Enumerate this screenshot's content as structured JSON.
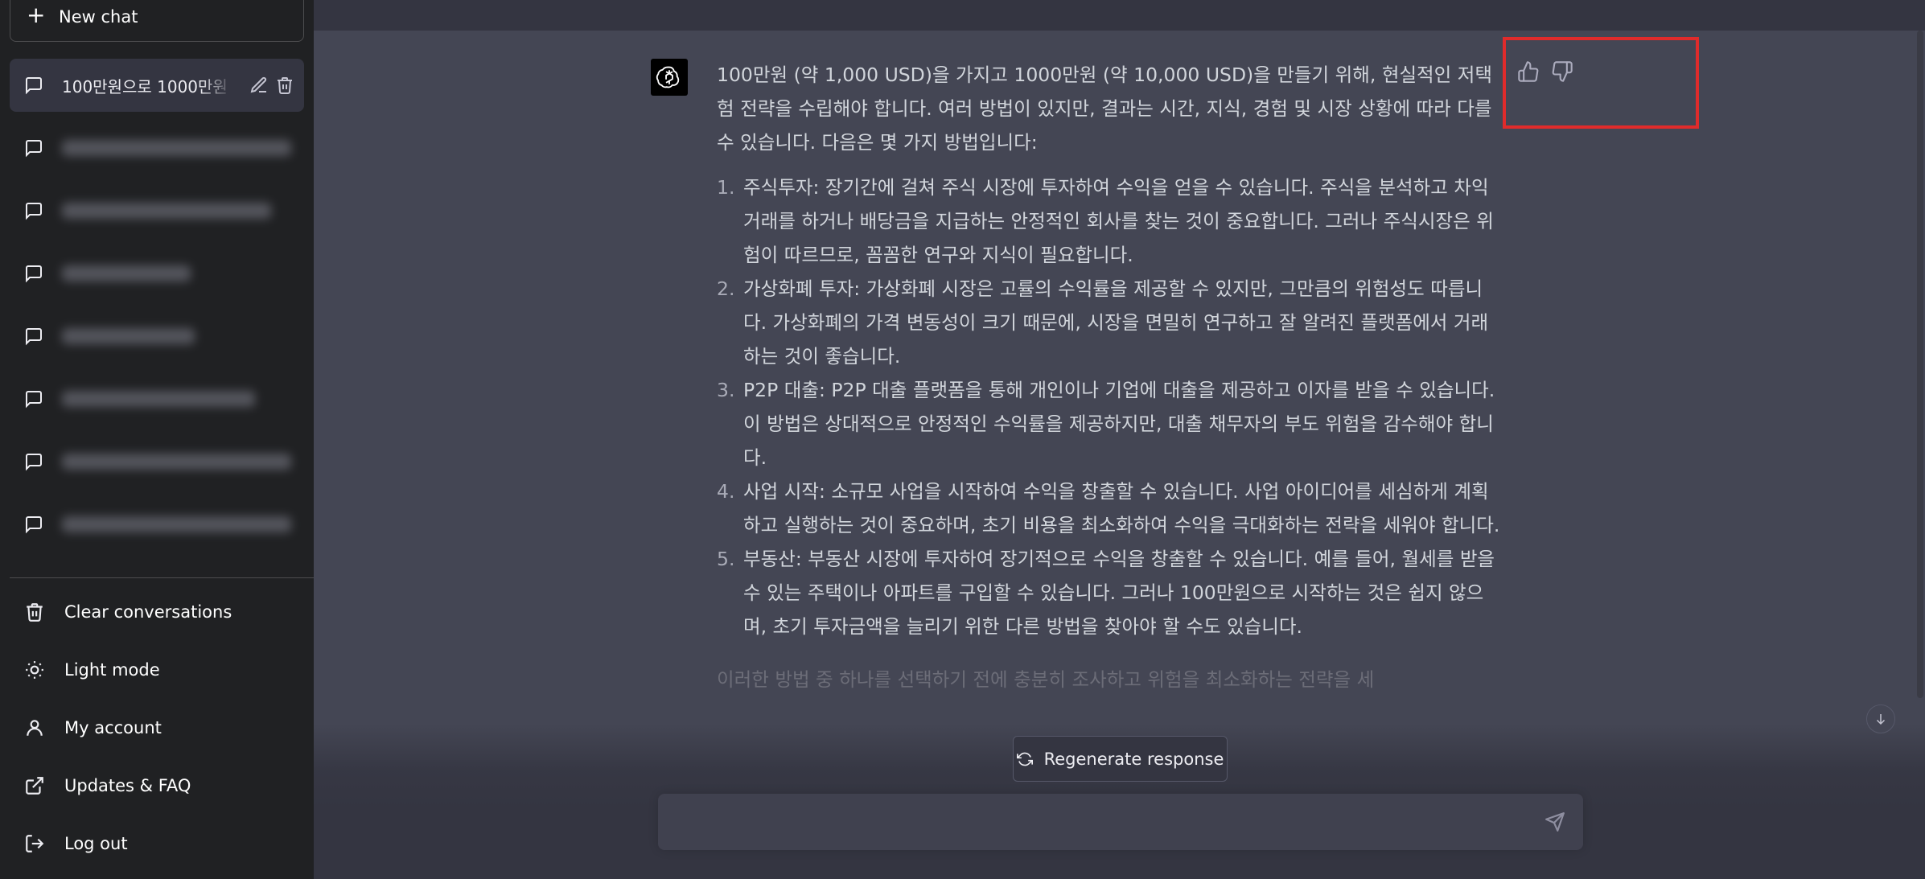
{
  "sidebar": {
    "new_chat_label": "New chat",
    "active_chat_title": "100만원으로 1000만원",
    "blurred_chat_count": 7,
    "menu": [
      {
        "label": "Clear conversations",
        "icon": "trash-icon"
      },
      {
        "label": "Light mode",
        "icon": "sun-icon"
      },
      {
        "label": "My account",
        "icon": "user-icon"
      },
      {
        "label": "Updates & FAQ",
        "icon": "external-link-icon"
      },
      {
        "label": "Log out",
        "icon": "logout-icon"
      }
    ]
  },
  "message": {
    "intro": "100만원 (약 1,000 USD)을 가지고 1000만원 (약 10,000 USD)을 만들기 위해, 현실적인 저택험 전략을 수립해야 합니다. 여러 방법이 있지만, 결과는 시간, 지식, 경험 및 시장 상황에 따라 다를 수 있습니다. 다음은 몇 가지 방법입니다:",
    "items": [
      {
        "num": "1.",
        "text": "주식투자: 장기간에 걸쳐 주식 시장에 투자하여 수익을 얻을 수 있습니다. 주식을 분석하고 차익거래를 하거나 배당금을 지급하는 안정적인 회사를 찾는 것이 중요합니다. 그러나 주식시장은 위험이 따르므로, 꼼꼼한 연구와 지식이 필요합니다."
      },
      {
        "num": "2.",
        "text": "가상화폐 투자: 가상화폐 시장은 고률의 수익률을 제공할 수 있지만, 그만큼의 위험성도 따릅니다. 가상화폐의 가격 변동성이 크기 때문에, 시장을 면밀히 연구하고 잘 알려진 플랫폼에서 거래하는 것이 좋습니다."
      },
      {
        "num": "3.",
        "text": "P2P 대출: P2P 대출 플랫폼을 통해 개인이나 기업에 대출을 제공하고 이자를 받을 수 있습니다. 이 방법은 상대적으로 안정적인 수익률을 제공하지만, 대출 채무자의 부도 위험을 감수해야 합니다."
      },
      {
        "num": "4.",
        "text": "사업 시작: 소규모 사업을 시작하여 수익을 창출할 수 있습니다. 사업 아이디어를 세심하게 계획하고 실행하는 것이 중요하며, 초기 비용을 최소화하여 수익을 극대화하는 전략을 세워야 합니다."
      },
      {
        "num": "5.",
        "text": "부동산: 부동산 시장에 투자하여 장기적으로 수익을 창출할 수 있습니다. 예를 들어, 월세를 받을 수 있는 주택이나 아파트를 구입할 수 있습니다. 그러나 100만원으로 시작하는 것은 쉽지 않으며, 초기 투자금액을 늘리기 위한 다른 방법을 찾아야 할 수도 있습니다."
      }
    ],
    "outro": "이러한 방법 중 하나를 선택하기 전에 충분히 조사하고 위험을 최소화하는 전략을 세"
  },
  "feedback": {
    "up_icon": "thumbs-up-icon",
    "down_icon": "thumbs-down-icon"
  },
  "regenerate_label": "Regenerate response",
  "input": {
    "value": ""
  },
  "colors": {
    "sidebar_bg": "#202123",
    "main_bg": "#444654",
    "highlight": "#e02b2b"
  }
}
